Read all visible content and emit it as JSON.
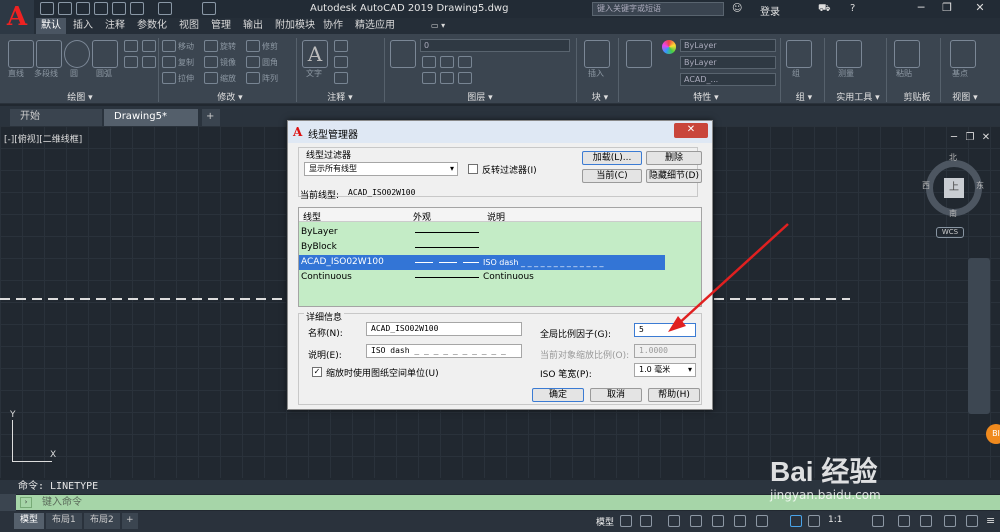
{
  "app": {
    "title": "Autodesk AutoCAD 2019    Drawing5.dwg",
    "search_placeholder": "键入关键字或短语",
    "login": "登录",
    "tabs": [
      "默认",
      "插入",
      "注释",
      "参数化",
      "视图",
      "管理",
      "输出",
      "附加模块",
      "协作",
      "精选应用"
    ]
  },
  "ribbon": {
    "panels": [
      "绘图",
      "修改",
      "注释",
      "图层",
      "块",
      "特性",
      "组",
      "实用工具",
      "剪贴板",
      "视图"
    ],
    "draw_labels": [
      "直线",
      "多段线",
      "圆",
      "圆弧"
    ],
    "modify_labels": [
      "移动",
      "旋转",
      "修剪",
      "复制",
      "镜像",
      "圆角",
      "拉伸",
      "缩放",
      "阵列"
    ],
    "annotate_label": "文字",
    "layer_value": "0",
    "prop_bylayer": "ByLayer",
    "prop_bylayer2": "ByLayer",
    "prop_linetype": "ACAD_...",
    "insert_label": "插入",
    "group_label": "组",
    "measure_label": "测量",
    "paste_label": "粘贴",
    "base_label": "基点"
  },
  "doc_tabs": [
    "开始",
    "Drawing5*"
  ],
  "viewport": {
    "label": "[-][俯视][二维线框]",
    "compass": {
      "n": "北",
      "s": "南",
      "e": "东",
      "w": "西",
      "top": "上"
    },
    "wcs": "WCS"
  },
  "dialog": {
    "title": "线型管理器",
    "filter_label": "线型过滤器",
    "filter_value": "显示所有线型",
    "invert_label": "反转过滤器(I)",
    "buttons": {
      "load": "加载(L)...",
      "delete": "删除",
      "current": "当前(C)",
      "hide_details": "隐藏细节(D)",
      "ok": "确定",
      "cancel": "取消",
      "help": "帮助(H)"
    },
    "current_linetype_label": "当前线型:",
    "current_linetype_value": "ACAD_ISO02W100",
    "columns": [
      "线型",
      "外观",
      "说明"
    ],
    "rows": [
      {
        "name": "ByLayer",
        "desc": ""
      },
      {
        "name": "ByBlock",
        "desc": ""
      },
      {
        "name": "ACAD_ISO02W100",
        "desc": "ISO dash _ _ _ _ _ _ _ _ _ _ _ _ _"
      },
      {
        "name": "Continuous",
        "desc": "Continuous"
      }
    ],
    "details": {
      "section_label": "详细信息",
      "name_label": "名称(N):",
      "name_value": "ACAD_ISO02W100",
      "desc_label": "说明(E):",
      "desc_value": "ISO dash _ _ _ _ _ _ _ _ _ _",
      "paperspace_label": "缩放时使用图纸空间单位(U)",
      "global_scale_label": "全局比例因子(G):",
      "global_scale_value": "5",
      "current_scale_label": "当前对象缩放比例(O):",
      "current_scale_value": "1.0000",
      "iso_pen_label": "ISO 笔宽(P):",
      "iso_pen_value": "1.0 毫米"
    }
  },
  "command": {
    "history": "命令: LINETYPE",
    "placeholder": "键入命令"
  },
  "status": {
    "tabs": [
      "模型",
      "布局1",
      "布局2"
    ],
    "model_label": "模型",
    "scale": "1:1"
  },
  "watermark": {
    "brand": "Bai 经验",
    "url": "jingyan.baidu.com"
  }
}
